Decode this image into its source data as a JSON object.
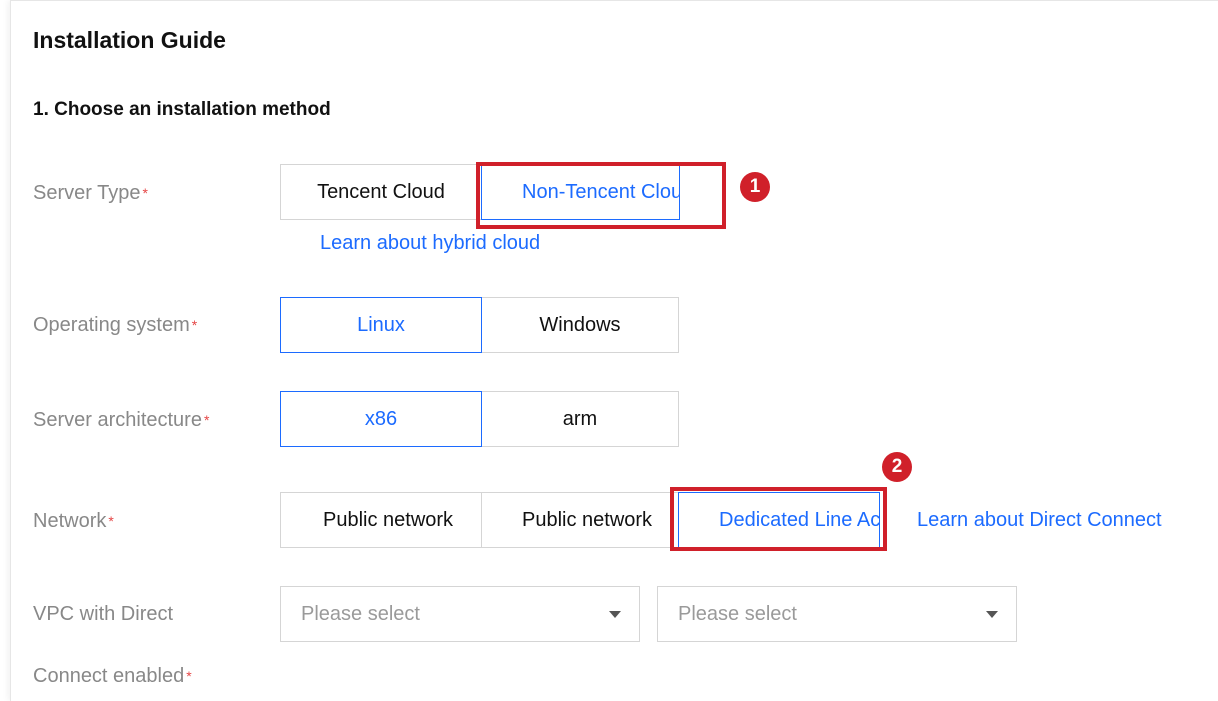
{
  "header": {
    "title": "Installation Guide"
  },
  "step": {
    "title": "1. Choose an installation method"
  },
  "fields": {
    "server_type": {
      "label": "Server Type",
      "required_mark": "*",
      "options": [
        "Tencent Cloud",
        "Non-Tencent Cloud"
      ],
      "link": "Learn about hybrid cloud",
      "annotation": "1"
    },
    "operating_system": {
      "label": "Operating system",
      "required_mark": "*",
      "options": [
        "Linux",
        "Windows"
      ]
    },
    "server_architecture": {
      "label": "Server architecture",
      "required_mark": "*",
      "options": [
        "x86",
        "arm"
      ]
    },
    "network": {
      "label": "Network",
      "required_mark": "*",
      "options": [
        "Public network",
        "Public network",
        "Dedicated Line Access"
      ],
      "link": "Learn about Direct Connect",
      "annotation": "2"
    },
    "vpc": {
      "label_line1": "VPC with Direct",
      "label_line2": "Connect enabled",
      "required_mark": "*",
      "select1_placeholder": "Please select",
      "select2_placeholder": "Please select"
    }
  },
  "colors": {
    "accent": "#1c6bff",
    "highlight": "#d0202a",
    "required": "#e54545"
  },
  "icons": {
    "dropdown": "caret-down-icon"
  }
}
